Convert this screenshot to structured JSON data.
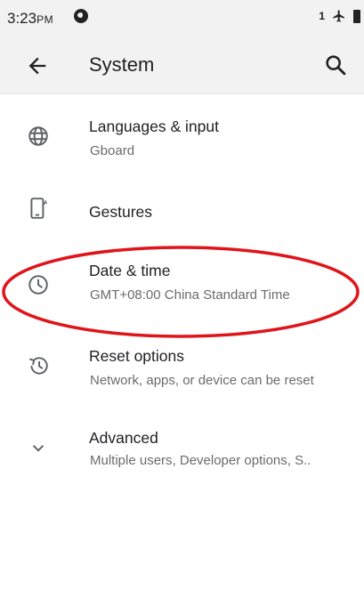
{
  "status_bar": {
    "time": "3:23",
    "ampm": "PM",
    "sim_number": "1",
    "icons": [
      "data-saver-icon",
      "sim-icon",
      "airplane-icon",
      "battery-icon"
    ]
  },
  "app_bar": {
    "title": "System",
    "back_icon": "arrow-back-icon",
    "search_icon": "search-icon"
  },
  "items": [
    {
      "label": "Languages & input",
      "sub": "Gboard",
      "icon": "globe-icon"
    },
    {
      "label": "Gestures",
      "sub": "",
      "icon": "phone-gesture-icon"
    },
    {
      "label": "Date & time",
      "sub": "GMT+08:00 China Standard Time",
      "icon": "clock-icon"
    },
    {
      "label": "Reset options",
      "sub": "Network, apps, or device can be reset",
      "icon": "restore-icon"
    },
    {
      "label": "Advanced",
      "sub": "Multiple users, Developer options, S..",
      "icon": "chevron-down-icon"
    }
  ],
  "annotation": {
    "color": "#e0151b"
  }
}
